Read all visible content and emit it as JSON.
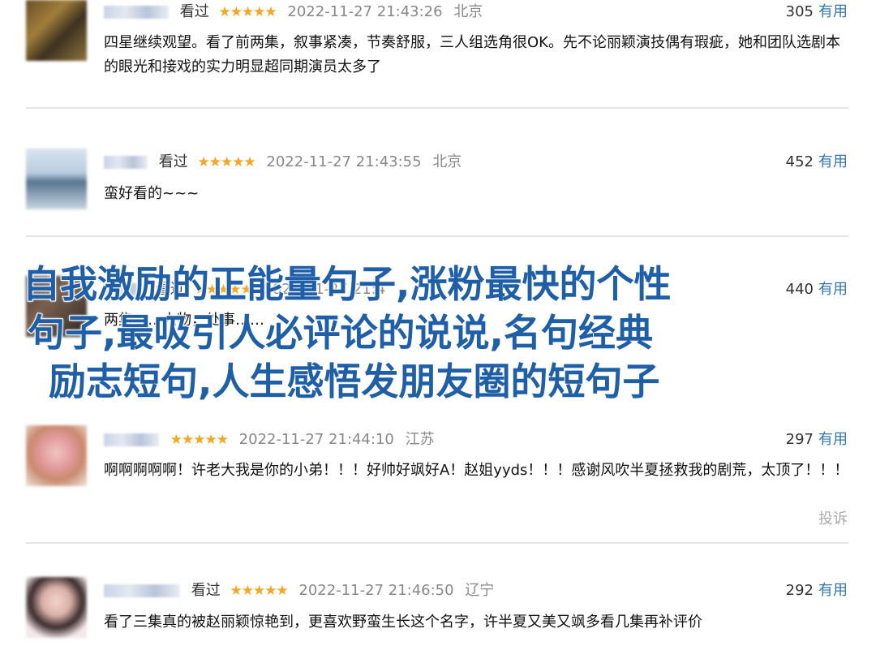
{
  "watched_label": "看过",
  "useful_label": "有用",
  "report_label": "投诉",
  "comments": [
    {
      "stars": "★★★★★",
      "time": "2022-11-27 21:43:26",
      "location": "北京",
      "votes": "305",
      "text": "四星继续观望。看了前两集，叙事紧凑，节奏舒服，三人组选角很OK。先不论丽颖演技偶有瑕疵，她和团队选剧本的眼光和接戏的实力明显超同期演员太多了"
    },
    {
      "stars": "★★★★★",
      "time": "2022-11-27 21:43:55",
      "location": "北京",
      "votes": "452",
      "text": "蛮好看的~~~"
    },
    {
      "stars": "★★★★★",
      "time": "2022-11-27 21:4",
      "location": "",
      "votes": "440",
      "text": "两集……人物，处事……"
    },
    {
      "stars": "★★★★★",
      "time": "2022-11-27 21:44:10",
      "location": "江苏",
      "votes": "297",
      "text": "啊啊啊啊啊！许老大我是你的小弟！！！好帅好飒好A！赵姐yyds！！！感谢风吹半夏拯救我的剧荒，太顶了！！！"
    },
    {
      "stars": "★★★★★",
      "time": "2022-11-27 21:46:50",
      "location": "辽宁",
      "votes": "292",
      "text": "看了三集真的被赵丽颖惊艳到，更喜欢野蛮生长这个名字，许半夏又美又飒多看几集再补评价"
    }
  ],
  "overlay": {
    "line1": "自我激励的正能量句子,涨粉最快的个性",
    "line2": "句子,最吸引人必评论的说说,名句经典",
    "line3": "励志短句,人生感悟发朋友圈的短句子"
  }
}
